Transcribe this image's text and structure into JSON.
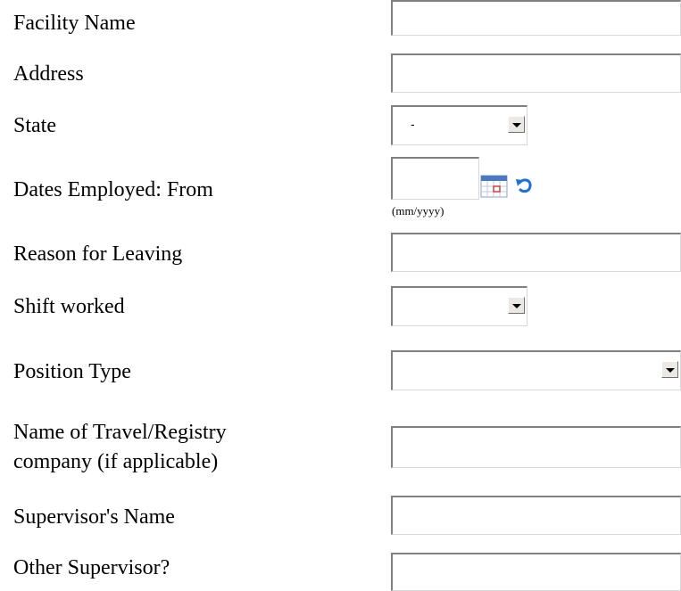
{
  "form": {
    "facility_name": {
      "label": "Facility Name",
      "value": ""
    },
    "address": {
      "label": "Address",
      "value": ""
    },
    "state": {
      "label": "State",
      "selected": "-"
    },
    "dates_employed": {
      "label": "Dates Employed: From",
      "value": "",
      "hint": "(mm/yyyy)",
      "calendar_icon": "calendar-icon",
      "reset_icon": "undo-icon"
    },
    "reason_for_leaving": {
      "label": "Reason for Leaving",
      "value": ""
    },
    "shift_worked": {
      "label": "Shift worked",
      "selected": ""
    },
    "position_type": {
      "label": "Position Type",
      "selected": ""
    },
    "travel_registry": {
      "label_line1": "Name of Travel/Registry",
      "label_line2": "company (if applicable)",
      "value": ""
    },
    "supervisor_name": {
      "label": "Supervisor's Name",
      "value": ""
    },
    "other_supervisor": {
      "label": "Other Supervisor?",
      "value": ""
    }
  },
  "colors": {
    "field_border_dark": "#808080",
    "field_border_light": "#d8d8d8",
    "button_face": "#ece9e4",
    "calendar_blue": "#4a78c2",
    "calendar_red": "#d04040",
    "undo_blue": "#1e6fd9"
  }
}
